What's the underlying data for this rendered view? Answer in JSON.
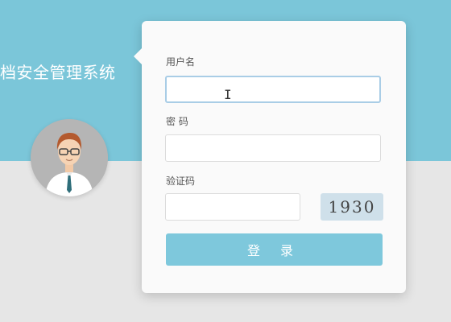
{
  "system_title": "档安全管理系统",
  "login_form": {
    "username_label": "用户名",
    "username_value": "",
    "password_label": "密 码",
    "password_value": "",
    "captcha_label": "验证码",
    "captcha_value": "",
    "captcha_code": "1930",
    "login_button": "登 录"
  },
  "colors": {
    "header_bg": "#7bc6d9",
    "button_bg": "#7ec8dc"
  },
  "icons": {
    "avatar": "user-avatar-icon",
    "cursor": "text-cursor-icon"
  }
}
